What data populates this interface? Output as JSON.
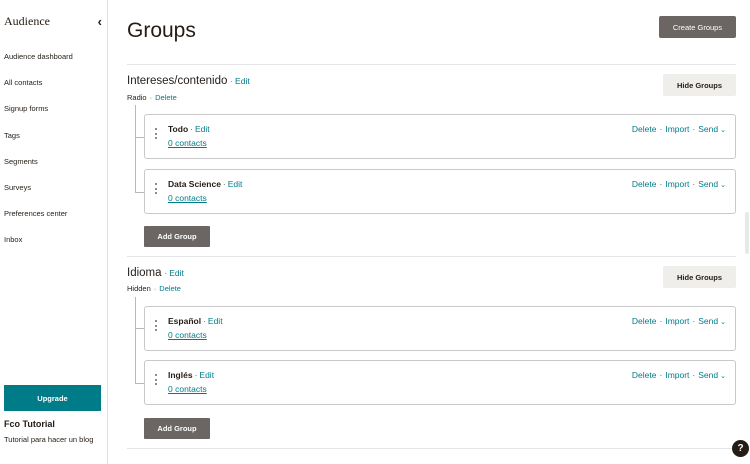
{
  "sidebar": {
    "title": "Audience",
    "collapse_icon": "chevron-left-icon",
    "items": [
      {
        "label": "Audience dashboard"
      },
      {
        "label": "All contacts"
      },
      {
        "label": "Signup forms"
      },
      {
        "label": "Tags"
      },
      {
        "label": "Segments"
      },
      {
        "label": "Surveys"
      },
      {
        "label": "Preferences center"
      },
      {
        "label": "Inbox"
      }
    ],
    "upgrade_label": "Upgrade",
    "account_name": "Fco Tutorial",
    "account_description": "Tutorial para hacer un blog"
  },
  "main": {
    "title": "Groups",
    "create_label": "Create Groups",
    "sep": "·",
    "categories": [
      {
        "name": "Intereses/contenido",
        "edit_label": "Edit",
        "type": "Radio",
        "delete_label": "Delete",
        "hide_label": "Hide Groups",
        "add_label": "Add Group",
        "groups": [
          {
            "name": "Todo",
            "edit": "Edit",
            "contacts": "0 contacts",
            "delete": "Delete",
            "import": "Import",
            "send": "Send"
          },
          {
            "name": "Data Science",
            "edit": "Edit",
            "contacts": "0 contacts",
            "delete": "Delete",
            "import": "Import",
            "send": "Send"
          }
        ]
      },
      {
        "name": "Idioma",
        "edit_label": "Edit",
        "type": "Hidden",
        "delete_label": "Delete",
        "hide_label": "Hide Groups",
        "add_label": "Add Group",
        "groups": [
          {
            "name": "Español",
            "edit": "Edit",
            "contacts": "0 contacts",
            "delete": "Delete",
            "import": "Import",
            "send": "Send"
          },
          {
            "name": "Inglés",
            "edit": "Edit",
            "contacts": "0 contacts",
            "delete": "Delete",
            "import": "Import",
            "send": "Send"
          }
        ]
      }
    ]
  },
  "help_label": "?",
  "colors": {
    "accent": "#007c89",
    "dark_button": "#6b6564",
    "light_button": "#efeeea",
    "text": "#241c15"
  }
}
